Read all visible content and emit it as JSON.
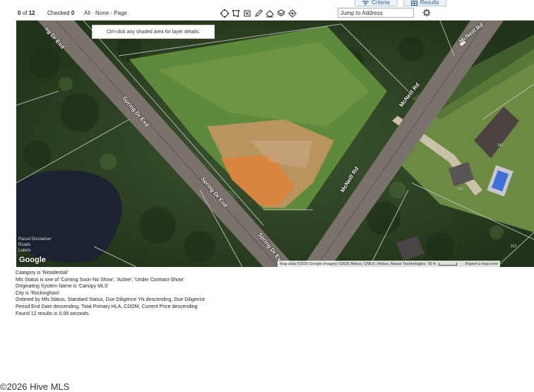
{
  "tabs": [
    {
      "label": "Criteria",
      "icon": "criteria-icon"
    },
    {
      "label": "Results",
      "icon": "results-grid-icon"
    }
  ],
  "toolbar": {
    "count_current": "0",
    "count_of": "of",
    "count_total": "12",
    "checked_label": "Checked",
    "checked_value": "0",
    "select_all": "All",
    "select_none": "None",
    "select_page": "Page",
    "separator": "·",
    "tools": [
      "circle-draw-icon",
      "polygon-draw-icon",
      "rectangle-draw-icon",
      "pencil-draw-icon",
      "eraser-icon",
      "layers-icon",
      "location-target-icon"
    ],
    "jump_placeholder": "Jump to Address",
    "settings_icon": "gear-icon"
  },
  "map": {
    "hint": "Ctrl-click any shaded area for layer details.",
    "streets": {
      "spring_top": "ng Dr Exd",
      "spring_mid": "Spring Dr Exd",
      "spring_lower": "Spring Dr Exd",
      "spring_bottom": "Spring Dr Exd",
      "mcneill_top": "McNeill Rd",
      "mcneill_mid": "McNeill Rd",
      "mcneill_lower": "McNeill Rd"
    },
    "lots": [
      "142",
      "116",
      "113"
    ],
    "legend": [
      "Parcel Disclaimer",
      "Roads",
      "Labels"
    ],
    "google": "Google",
    "attribution": "Map data ©2025 Google Imagery ©2025 Airbus, CNES / Airbus, Maxar Technologies",
    "scale": "50 ft",
    "report": "Report a map error"
  },
  "criteria": [
    "Category is 'Residential'",
    "Mls Status is one of 'Coming Soon-No Show', 'Active', 'Under Contract-Show'",
    "Originating System Name is 'Canopy MLS'",
    "City is 'Rockingham'",
    "Ordered by Mls Status, Standard Status, Due Diligence YN descending, Due Diligence",
    "Period End Date descending, Total Primary HLA, CDOM, Current Price descending",
    "Found 12 results in 0.09 seconds."
  ],
  "footer": "©2026 Hive MLS"
}
